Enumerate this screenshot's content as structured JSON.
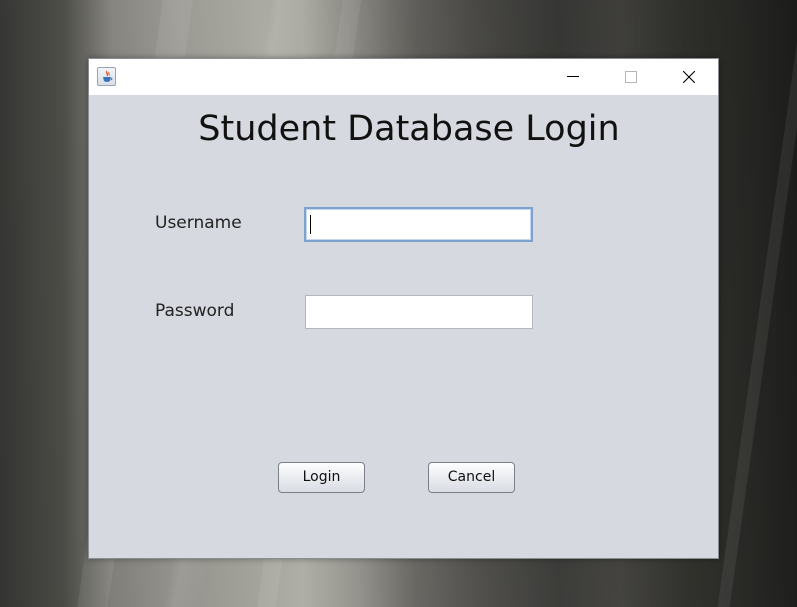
{
  "window": {
    "title": "",
    "icon": "java-cup-icon",
    "controls": [
      "minimize-icon",
      "maximize-icon",
      "close-icon"
    ]
  },
  "form": {
    "heading": "Student Database Login",
    "username_label": "Username",
    "username_value": "",
    "password_label": "Password",
    "password_value": "",
    "login_label": "Login",
    "cancel_label": "Cancel"
  },
  "colors": {
    "window_background": "#d6d9e0",
    "titlebar_background": "#ffffff",
    "focused_field_border": "#7da2ce"
  }
}
